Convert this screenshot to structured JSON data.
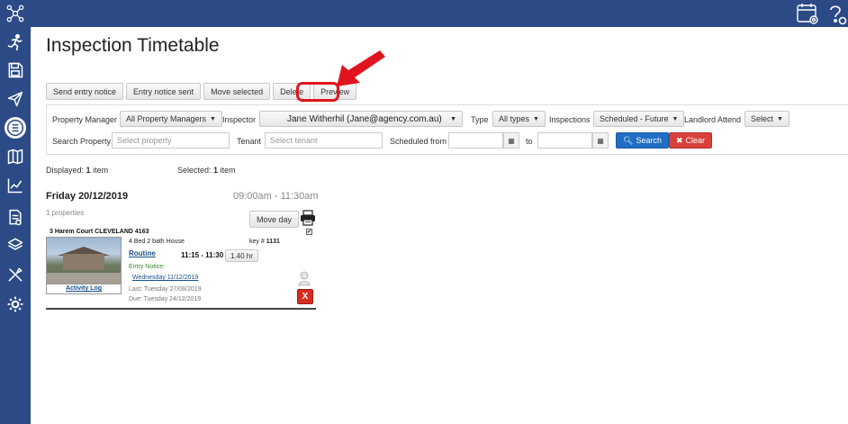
{
  "page": {
    "title": "Inspection Timetable"
  },
  "sidebar": {
    "icons": [
      "network-logo-icon",
      "running-person-icon",
      "save-icon",
      "send-icon",
      "list-icon",
      "map-icon",
      "chart-icon",
      "document-icon",
      "layers-icon",
      "tools-icon",
      "settings-icon"
    ]
  },
  "topbar": {
    "icons": [
      "calendar-settings-icon",
      "help-icon"
    ]
  },
  "toolbar": {
    "send_entry_notice": "Send entry notice",
    "entry_notice_sent": "Entry notice sent",
    "move_selected": "Move selected",
    "delete": "Delete",
    "preview": "Preview"
  },
  "filters": {
    "property_manager_label": "Property Manager",
    "property_manager_value": "All Property Managers",
    "inspector_label": "Inspector",
    "inspector_value": "Jane Witherhil  (Jane@agency.com.au)",
    "type_label": "Type",
    "type_value": "All types",
    "inspections_label": "Inspections",
    "inspections_value": "Scheduled - Future",
    "landlord_attend_label": "Landlord Attend",
    "landlord_attend_value": "Select",
    "search_property_label": "Search Property",
    "search_property_placeholder": "Select property",
    "tenant_label": "Tenant",
    "tenant_placeholder": "Select tenant",
    "scheduled_from_label": "Scheduled from",
    "to_label": "to",
    "search_button": "Search",
    "clear_button": "Clear"
  },
  "stats": {
    "displayed_label": "Displayed:",
    "displayed_count": "1",
    "displayed_suffix": "item",
    "selected_label": "Selected:",
    "selected_count": "1",
    "selected_suffix": "item"
  },
  "day": {
    "title": "Friday 20/12/2019",
    "time_range": "09:00am - 11:30am",
    "properties_count": "1 properties",
    "move_day": "Move day"
  },
  "property": {
    "address": "3 Harem Court CLEVELAND 4163",
    "type": "4 Bed 2 bath House",
    "key_label": "key #",
    "key_number": "1131",
    "inspection_type": "Routine",
    "time": "11:15 - 11:30",
    "duration": "1.40 hr",
    "entry_notice_label": "Entry Notice:",
    "entry_notice_date": "Wednesday 11/12/2019",
    "last": "Last:  Tuesday 27/08/2019",
    "due": "Due:  Tuesday 24/12/2019",
    "activity_log": "Activity Log",
    "delete_mark": "X",
    "checked": true
  },
  "colors": {
    "nav_bg": "#2b4a86",
    "search_btn": "#1f6dc4",
    "clear_btn": "#d9403c",
    "highlight": "#e0141e",
    "link": "#1a4f8b",
    "entry_notice_green": "#3a8a2e"
  }
}
